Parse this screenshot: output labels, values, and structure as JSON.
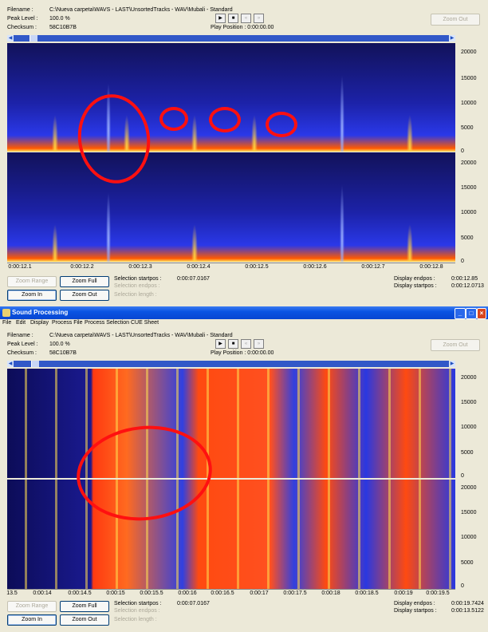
{
  "top": {
    "filename_label": "Filename :",
    "filename_value": "C:\\Nueva carpeta\\WAVS - LAST\\UnsortedTracks - WAV\\Mubali - Standard",
    "peak_label": "Peak Level :",
    "peak_value": "100.0 %",
    "checksum_label": "Checksum :",
    "checksum_value": "58C10B7B",
    "play_position": "Play Position : 0:00:00.00",
    "zoom_out_top": "Zoom Out",
    "y_ticks": [
      "20000",
      "15000",
      "10000",
      "5000",
      "0",
      "20000",
      "15000",
      "10000",
      "5000",
      "0"
    ],
    "x_ticks": [
      "0:00:12.1",
      "0:00:12.2",
      "0:00:12.3",
      "0:00:12.4",
      "0:00:12.5",
      "0:00:12.6",
      "0:00:12.7",
      "0:00:12.8"
    ],
    "zoom_range": "Zoom Range",
    "zoom_full": "Zoom Full",
    "zoom_in": "Zoom In",
    "zoom_out": "Zoom Out",
    "selection_startpos_label": "Selection startpos :",
    "selection_startpos_value": "0:00:07.0167",
    "selection_endpos_label": "Selection endpos :",
    "selection_length_label": "Selection length :",
    "display_endpos_label": "Display endpos :",
    "display_endpos_value": "0:00:12.85",
    "display_startpos_label": "Display startpos :",
    "display_startpos_value": "0:00:12.0713"
  },
  "window": {
    "title": "Sound Processing",
    "menu": [
      "File",
      "Edit",
      "Display",
      "Process File",
      "Process Selection",
      "CUE Sheet"
    ]
  },
  "bottom": {
    "filename_label": "Filename :",
    "filename_value": "C:\\Nueva carpeta\\WAVS - LAST\\UnsortedTracks - WAV\\Mubali - Standard",
    "peak_label": "Peak Level :",
    "peak_value": "100.0 %",
    "checksum_label": "Checksum :",
    "checksum_value": "58C10B7B",
    "play_position": "Play Position : 0:00:00.00",
    "zoom_out_top": "Zoom Out",
    "y_ticks": [
      "20000",
      "15000",
      "10000",
      "5000",
      "0",
      "20000",
      "15000",
      "10000",
      "5000",
      "0"
    ],
    "x_ticks": [
      "13.5",
      "0:00:14",
      "0:00:14.5",
      "0:00:15",
      "0:00:15.5",
      "0:00:16",
      "0:00:16.5",
      "0:00:17",
      "0:00:17.5",
      "0:00:18",
      "0:00:18.5",
      "0:00:19",
      "0:00:19.5"
    ],
    "zoom_range": "Zoom Range",
    "zoom_full": "Zoom Full",
    "zoom_in": "Zoom In",
    "zoom_out": "Zoom Out",
    "selection_startpos_label": "Selection startpos :",
    "selection_startpos_value": "0:00:07.0167",
    "selection_endpos_label": "Selection endpos :",
    "selection_length_label": "Selection length :",
    "display_endpos_label": "Display endpos :",
    "display_endpos_value": "0:00:19.7424",
    "display_startpos_label": "Display startpos :",
    "display_startpos_value": "0:00:13.5122"
  },
  "transport": {
    "play_icon": "play-icon",
    "stop_icon": "stop-icon",
    "rewind_icon": "rewind-icon",
    "forward_icon": "fast-forward-icon"
  },
  "colors": {
    "spectrogram_low": "#0a0a3c",
    "spectrogram_mid": "#2a3cf0",
    "spectrogram_high": "#ff3a10",
    "annotation": "#ff1010"
  }
}
